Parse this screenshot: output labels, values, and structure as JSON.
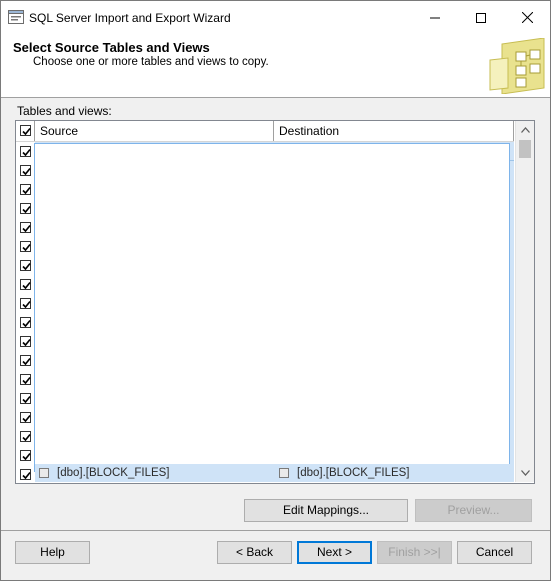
{
  "window": {
    "title": "SQL Server Import and Export Wizard"
  },
  "header": {
    "title": "Select Source Tables and Views",
    "subtitle": "Choose one or more tables and views to copy."
  },
  "section_label": "Tables and views:",
  "grid": {
    "columns": [
      "Source",
      "Destination"
    ],
    "row_count": 18,
    "all_checked": true,
    "visible_partial_row": {
      "source": "[dbo].[BLOCK_FILES]",
      "destination": "[dbo].[BLOCK_FILES]"
    }
  },
  "buttons": {
    "edit_mappings": "Edit Mappings...",
    "preview": "Preview...",
    "help": "Help",
    "back": "< Back",
    "next": "Next >",
    "finish": "Finish >>|",
    "cancel": "Cancel"
  },
  "icons": [
    "app-icon",
    "minimize-icon",
    "maximize-icon",
    "close-icon",
    "wizard-graphic-icon",
    "checkbox-icon",
    "scroll-up-icon",
    "scroll-down-icon"
  ],
  "colors": {
    "selection": "#cfe3f7",
    "accent": "#0078d7"
  }
}
